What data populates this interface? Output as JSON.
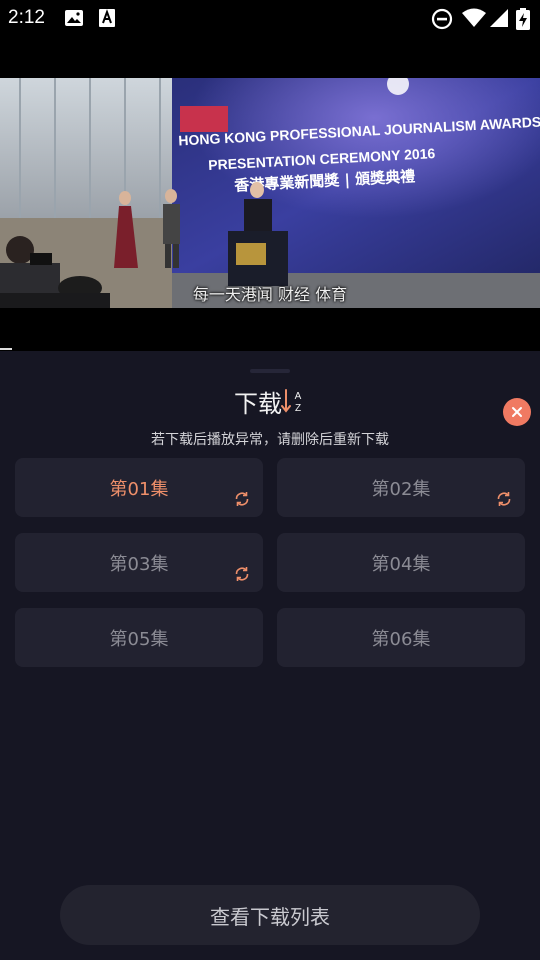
{
  "status_bar": {
    "time": "2:12",
    "icons": [
      "image-icon",
      "font-a-icon",
      "do-not-disturb-icon",
      "wifi-icon",
      "signal-icon",
      "battery-charging-icon"
    ]
  },
  "video": {
    "subtitle": "每一天港闻 财经 体育",
    "banner_line1": "HONG KONG PROFESSIONAL JOURNALISM AWARDS",
    "banner_line2": "PRESENTATION CEREMONY 2016",
    "banner_line3": "香港專業新聞獎 | 頒獎典禮"
  },
  "sheet": {
    "title": "下载",
    "sort_icon": "sort-a-z-icon",
    "close_icon": "close-icon",
    "notice": "若下载后播放异常，请删除后重新下载",
    "episodes": [
      {
        "label": "第01集",
        "active": true,
        "syncing": true
      },
      {
        "label": "第02集",
        "active": false,
        "syncing": true
      },
      {
        "label": "第03集",
        "active": false,
        "syncing": true
      },
      {
        "label": "第04集",
        "active": false,
        "syncing": false
      },
      {
        "label": "第05集",
        "active": false,
        "syncing": false
      },
      {
        "label": "第06集",
        "active": false,
        "syncing": false
      }
    ],
    "view_list_button": "查看下载列表"
  },
  "colors": {
    "accent": "#ee8f6a",
    "close": "#f07a62",
    "sheet_bg": "#161623",
    "card_bg": "#222230"
  }
}
